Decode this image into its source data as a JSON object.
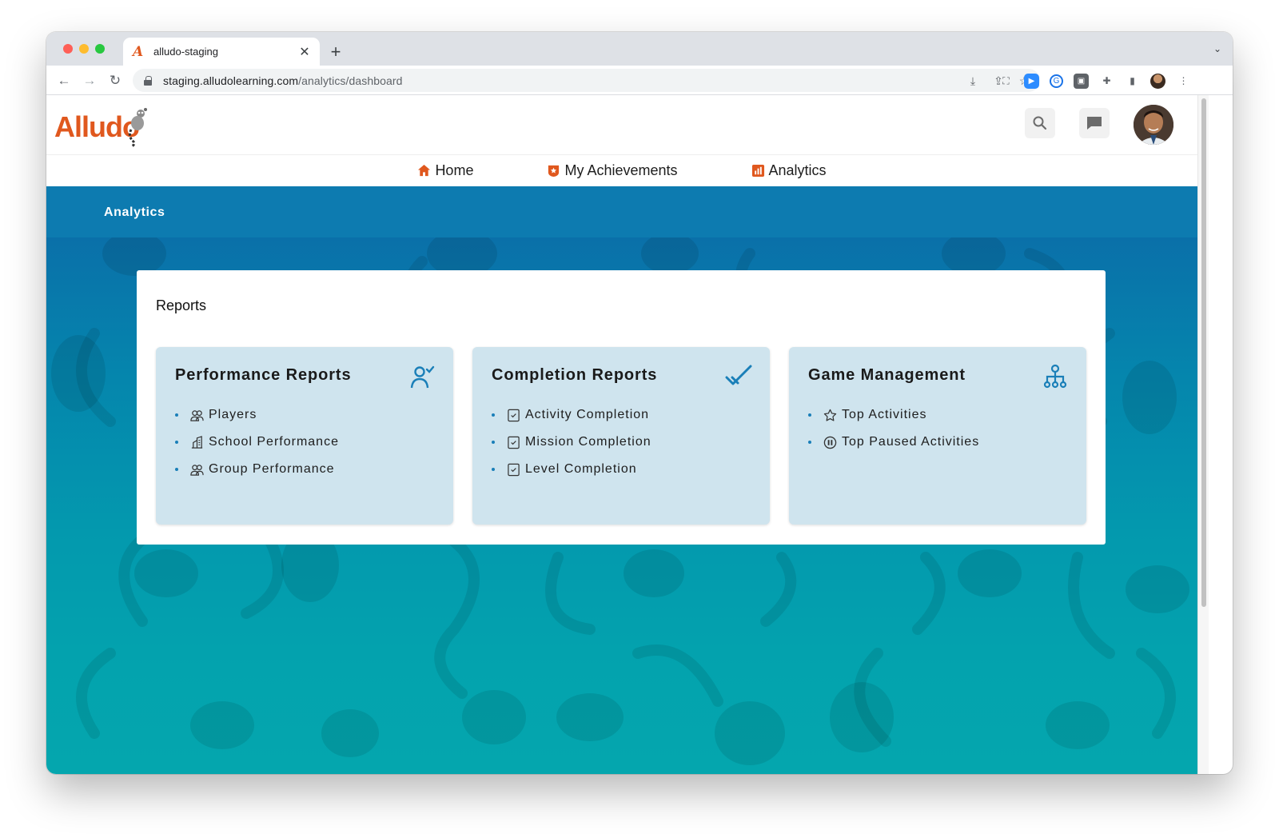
{
  "browser": {
    "tab_title": "alludo-staging",
    "new_tab_symbol": "+",
    "url_host": "staging.alludolearning.com",
    "url_path": "/analytics/dashboard"
  },
  "header": {
    "logo_text": "Alludo"
  },
  "nav": {
    "items": [
      {
        "label": "Home",
        "icon": "home-icon"
      },
      {
        "label": "My Achievements",
        "icon": "badge-icon"
      },
      {
        "label": "Analytics",
        "icon": "chart-icon"
      }
    ]
  },
  "banner": {
    "title": "Analytics"
  },
  "reports": {
    "title": "Reports",
    "cards": [
      {
        "title": "Performance Reports",
        "icon": "user-check-icon",
        "items": [
          {
            "label": "Players",
            "icon": "users-icon"
          },
          {
            "label": "School Performance",
            "icon": "building-icon"
          },
          {
            "label": "Group Performance",
            "icon": "users-icon"
          }
        ]
      },
      {
        "title": "Completion Reports",
        "icon": "check-icon",
        "items": [
          {
            "label": "Activity Completion",
            "icon": "checkbox-icon"
          },
          {
            "label": "Mission Completion",
            "icon": "checkbox-icon"
          },
          {
            "label": "Level Completion",
            "icon": "checkbox-icon"
          }
        ]
      },
      {
        "title": "Game Management",
        "icon": "hierarchy-icon",
        "items": [
          {
            "label": "Top Activities",
            "icon": "star-icon"
          },
          {
            "label": "Top Paused Activities",
            "icon": "pause-circle-icon"
          }
        ]
      }
    ]
  },
  "colors": {
    "brand_orange": "#e0581e",
    "banner_blue": "#0d7bb0",
    "card_bg": "#cfe4ee",
    "accent_blue": "#1a7fb8"
  }
}
